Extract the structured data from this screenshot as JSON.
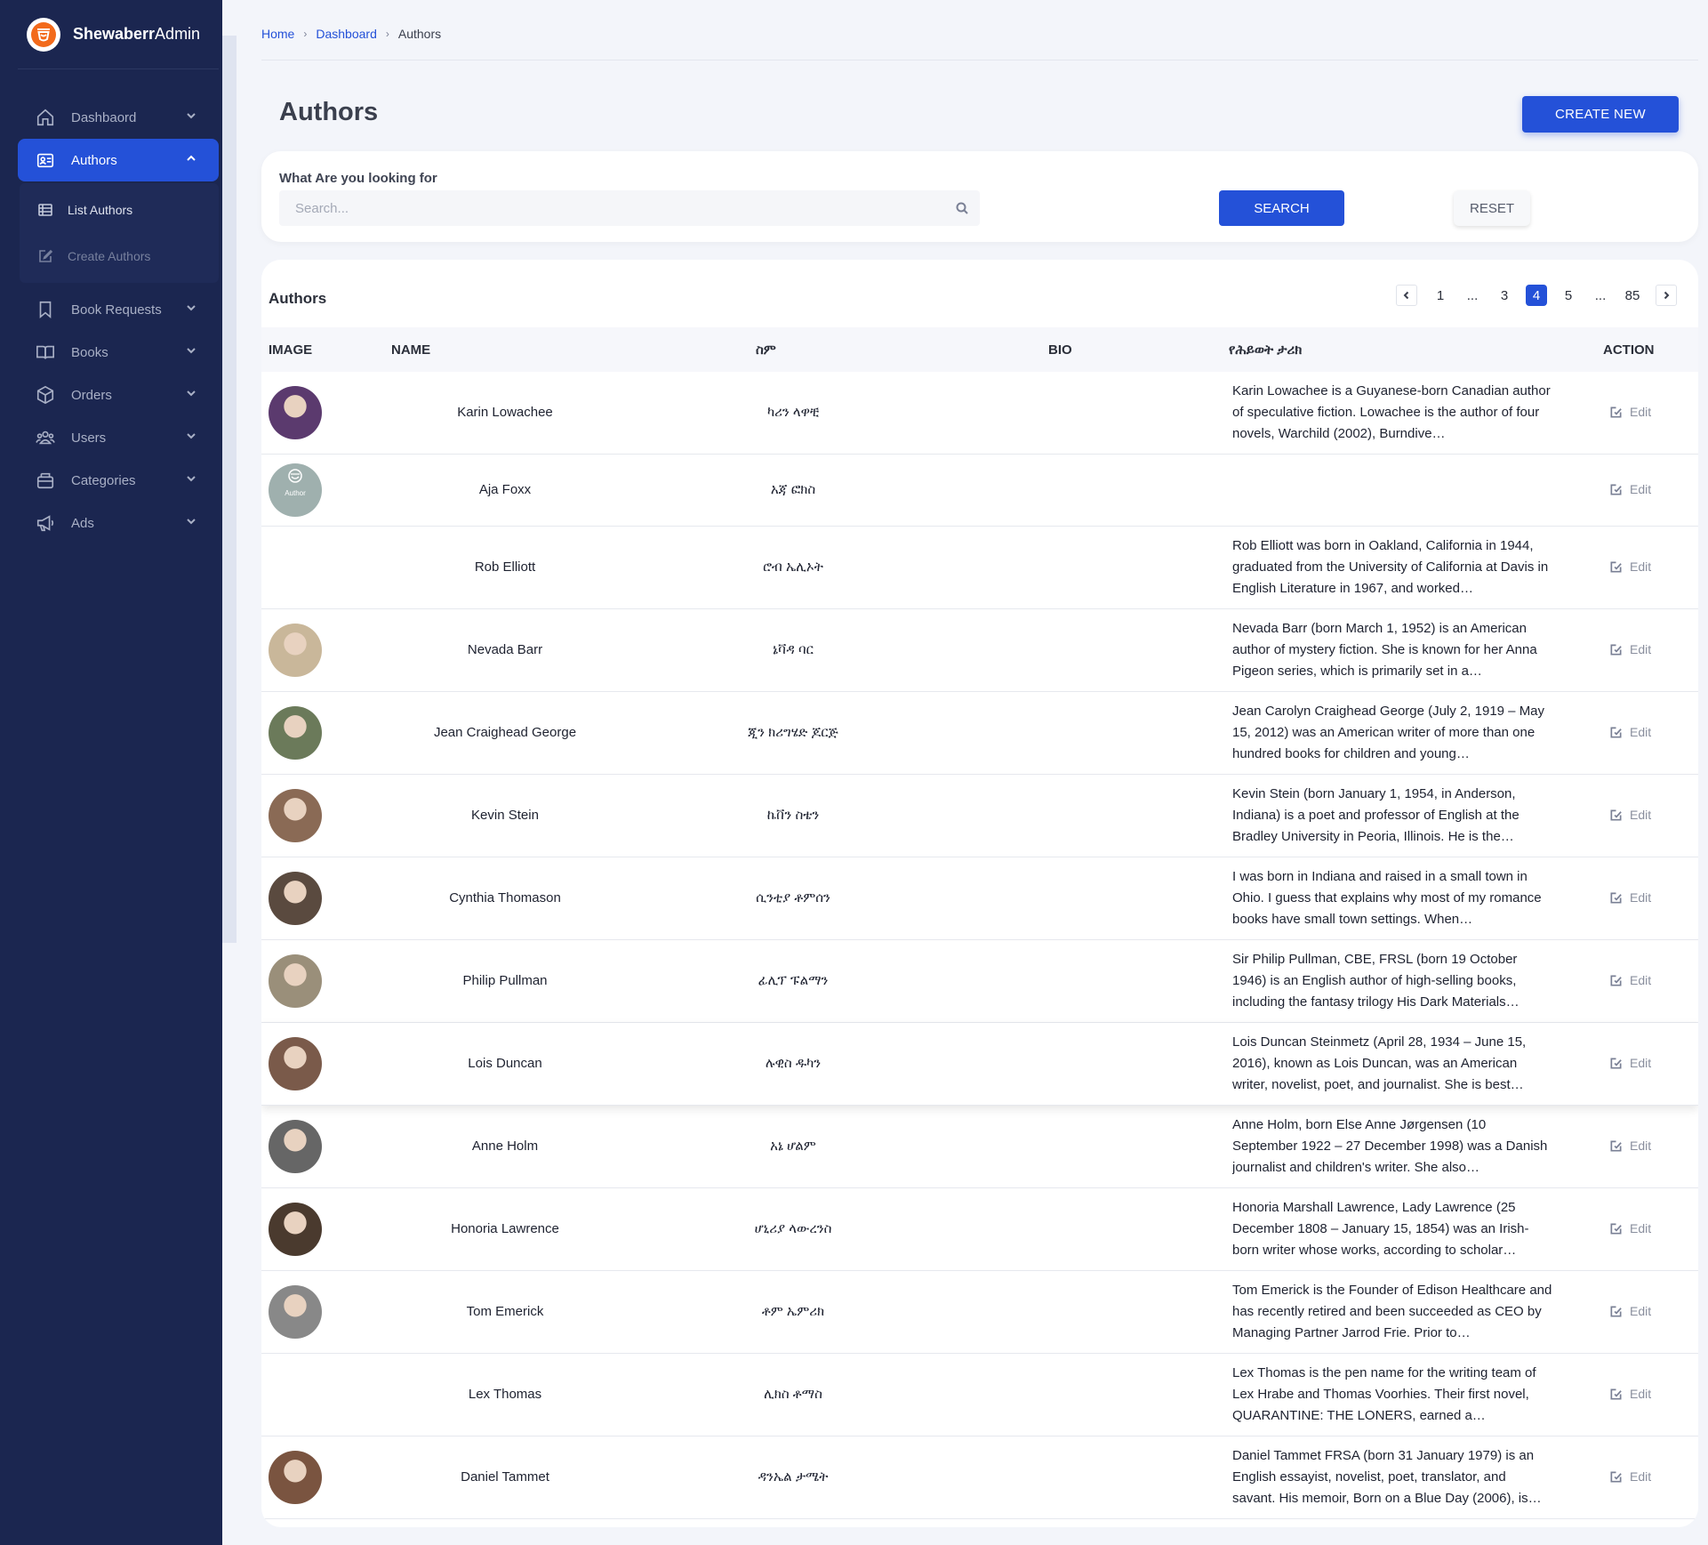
{
  "brand": {
    "name_bold": "Shewaberr",
    "name_rest": "Admin"
  },
  "sidebar": {
    "items": [
      {
        "label": "Dashbaord",
        "icon": "home-icon"
      },
      {
        "label": "Authors",
        "icon": "id-card-icon",
        "active": true
      },
      {
        "label": "Book Requests",
        "icon": "bookmark-icon"
      },
      {
        "label": "Books",
        "icon": "open-book-icon"
      },
      {
        "label": "Orders",
        "icon": "box-icon"
      },
      {
        "label": "Users",
        "icon": "users-icon"
      },
      {
        "label": "Categories",
        "icon": "layers-icon"
      },
      {
        "label": "Ads",
        "icon": "megaphone-icon"
      }
    ],
    "sub": [
      {
        "label": "List Authors",
        "icon": "table-icon"
      },
      {
        "label": "Create Authors",
        "icon": "edit-icon"
      }
    ]
  },
  "breadcrumb": [
    "Home",
    "Dashboard",
    "Authors"
  ],
  "page": {
    "title": "Authors",
    "create_label": "CREATE NEW"
  },
  "search": {
    "label": "What Are you looking for",
    "placeholder": "Search...",
    "search_label": "SEARCH",
    "reset_label": "RESET"
  },
  "table": {
    "title": "Authors",
    "pagination": {
      "pages": [
        "1",
        "...",
        "3",
        "4",
        "5",
        "...",
        "85"
      ],
      "current": "4"
    },
    "headers": {
      "image": "IMAGE",
      "name": "NAME",
      "am": "ስም",
      "bio": "BIO",
      "am_bio": "የሕይወት ታሪክ",
      "action": "ACTION"
    },
    "edit_label": "Edit",
    "rows": [
      {
        "name": "Karin Lowachee",
        "am": "ካሪን ላዋቺ",
        "bio": "Karin Lowachee is a Guyanese-born Canadian author of speculative fiction. Lowachee is the author of four novels, Warchild (2002), Burndive…",
        "avatar": "photo"
      },
      {
        "name": "Aja Foxx",
        "am": "አጃ ፎክስ",
        "bio": "",
        "avatar": "placeholder"
      },
      {
        "name": "Rob Elliott",
        "am": "ሮብ ኤሊኦት",
        "bio": "Rob Elliott was born in Oakland, California in 1944, graduated from the University of California at Davis in English Literature in 1967, and worked…",
        "avatar": "none"
      },
      {
        "name": "Nevada Barr",
        "am": "ኔቫዳ ባር",
        "bio": "Nevada Barr (born March 1, 1952) is an American author of mystery fiction. She is known for her Anna Pigeon series, which is primarily set in a…",
        "avatar": "photo"
      },
      {
        "name": "Jean Craighead George",
        "am": "ጂን ክሪግሄድ ጆርጅ",
        "bio": "Jean Carolyn Craighead George (July 2, 1919 – May 15, 2012) was an American writer of more than one hundred books for children and young…",
        "avatar": "photo"
      },
      {
        "name": "Kevin Stein",
        "am": "ኬቨን ስቴን",
        "bio": "Kevin Stein (born January 1, 1954, in Anderson, Indiana) is a poet and professor of English at the Bradley University in Peoria, Illinois. He is the…",
        "avatar": "photo"
      },
      {
        "name": "Cynthia Thomason",
        "am": "ሲንቲያ ቶምሰን",
        "bio": "I was born in Indiana and raised in a small town in Ohio. I guess that explains why most of my romance books have small town settings. When…",
        "avatar": "photo"
      },
      {
        "name": "Philip Pullman",
        "am": "ፊሊፕ ፑልማን",
        "bio": "Sir Philip Pullman, CBE, FRSL (born 19 October 1946) is an English author of high-selling books, including the fantasy trilogy His Dark Materials…",
        "avatar": "photo"
      },
      {
        "name": "Lois Duncan",
        "am": "ሉዊስ ዱካን",
        "bio": "Lois Duncan Steinmetz (April 28, 1934 – June 15, 2016), known as Lois Duncan, was an American writer, novelist, poet, and journalist. She is best…",
        "avatar": "photo"
      },
      {
        "name": "Anne Holm",
        "am": "አኔ ሆልም",
        "bio": "Anne Holm, born Else Anne Jørgensen (10 September 1922 – 27 December 1998) was a Danish journalist and children's writer. She also…",
        "avatar": "photo"
      },
      {
        "name": "Honoria Lawrence",
        "am": "ሆኒሪያ ላውረንስ",
        "bio": "Honoria Marshall Lawrence, Lady Lawrence (25 December 1808 – January 15, 1854) was an Irish-born writer whose works, according to scholar…",
        "avatar": "photo"
      },
      {
        "name": "Tom Emerick",
        "am": "ቶም ኤምሪክ",
        "bio": "Tom Emerick is the Founder of Edison Healthcare and has recently retired and been succeeded as CEO by Managing Partner Jarrod Frie. Prior to…",
        "avatar": "photo"
      },
      {
        "name": "Lex Thomas",
        "am": "ሊክስ ቶማስ",
        "bio": "Lex Thomas is the pen name for the writing team of Lex Hrabe and Thomas Voorhies. Their first novel, QUARANTINE: THE LONERS, earned a…",
        "avatar": "none"
      },
      {
        "name": "Daniel Tammet",
        "am": "ዳንኤል ታሜት",
        "bio": "Daniel Tammet FRSA (born 31 January 1979) is an English essayist, novelist, poet, translator, and savant. His memoir, Born on a Blue Day (2006), is…",
        "avatar": "photo"
      }
    ]
  },
  "colors": {
    "sidebar": "#1b2650",
    "accent": "#2451d8",
    "page_bg": "#f3f5fa"
  }
}
